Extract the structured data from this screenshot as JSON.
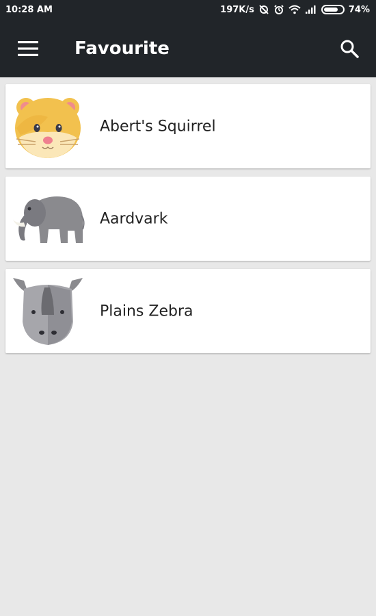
{
  "status_bar": {
    "time": "10:28 AM",
    "network_speed": "197K/s",
    "battery_percent": "74%",
    "battery_level": 0.74,
    "icons": [
      "sync-off-icon",
      "alarm-icon",
      "wifi-icon",
      "signal-icon",
      "battery-icon"
    ]
  },
  "app_bar": {
    "title": "Favourite",
    "menu_icon": "hamburger-menu-icon",
    "search_icon": "search-icon",
    "background": "#212529"
  },
  "favourites": [
    {
      "name": "Abert's Squirrel",
      "icon": "hamster-face-icon"
    },
    {
      "name": "Aardvark",
      "icon": "elephant-icon"
    },
    {
      "name": "Plains Zebra",
      "icon": "rhino-face-icon"
    }
  ]
}
